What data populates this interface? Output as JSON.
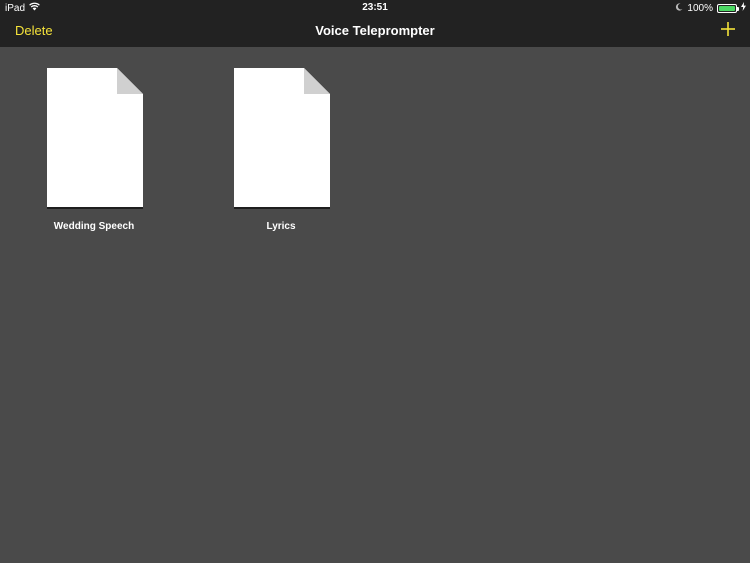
{
  "status_bar": {
    "device": "iPad",
    "time": "23:51",
    "battery_percent": "100%",
    "battery_level": 1.0,
    "icons": [
      "wifi-icon",
      "moon-icon",
      "battery-icon",
      "charging-icon"
    ]
  },
  "nav": {
    "delete_label": "Delete",
    "title": "Voice Teleprompter",
    "add_icon": "plus-icon"
  },
  "documents": [
    {
      "label": "Wedding Speech"
    },
    {
      "label": "Lyrics"
    }
  ],
  "colors": {
    "background": "#4a4a4a",
    "bar": "#222222",
    "accent": "#f5e33a",
    "battery": "#4cd964",
    "page": "#ffffff",
    "page_fold": "#d0d0d0"
  }
}
